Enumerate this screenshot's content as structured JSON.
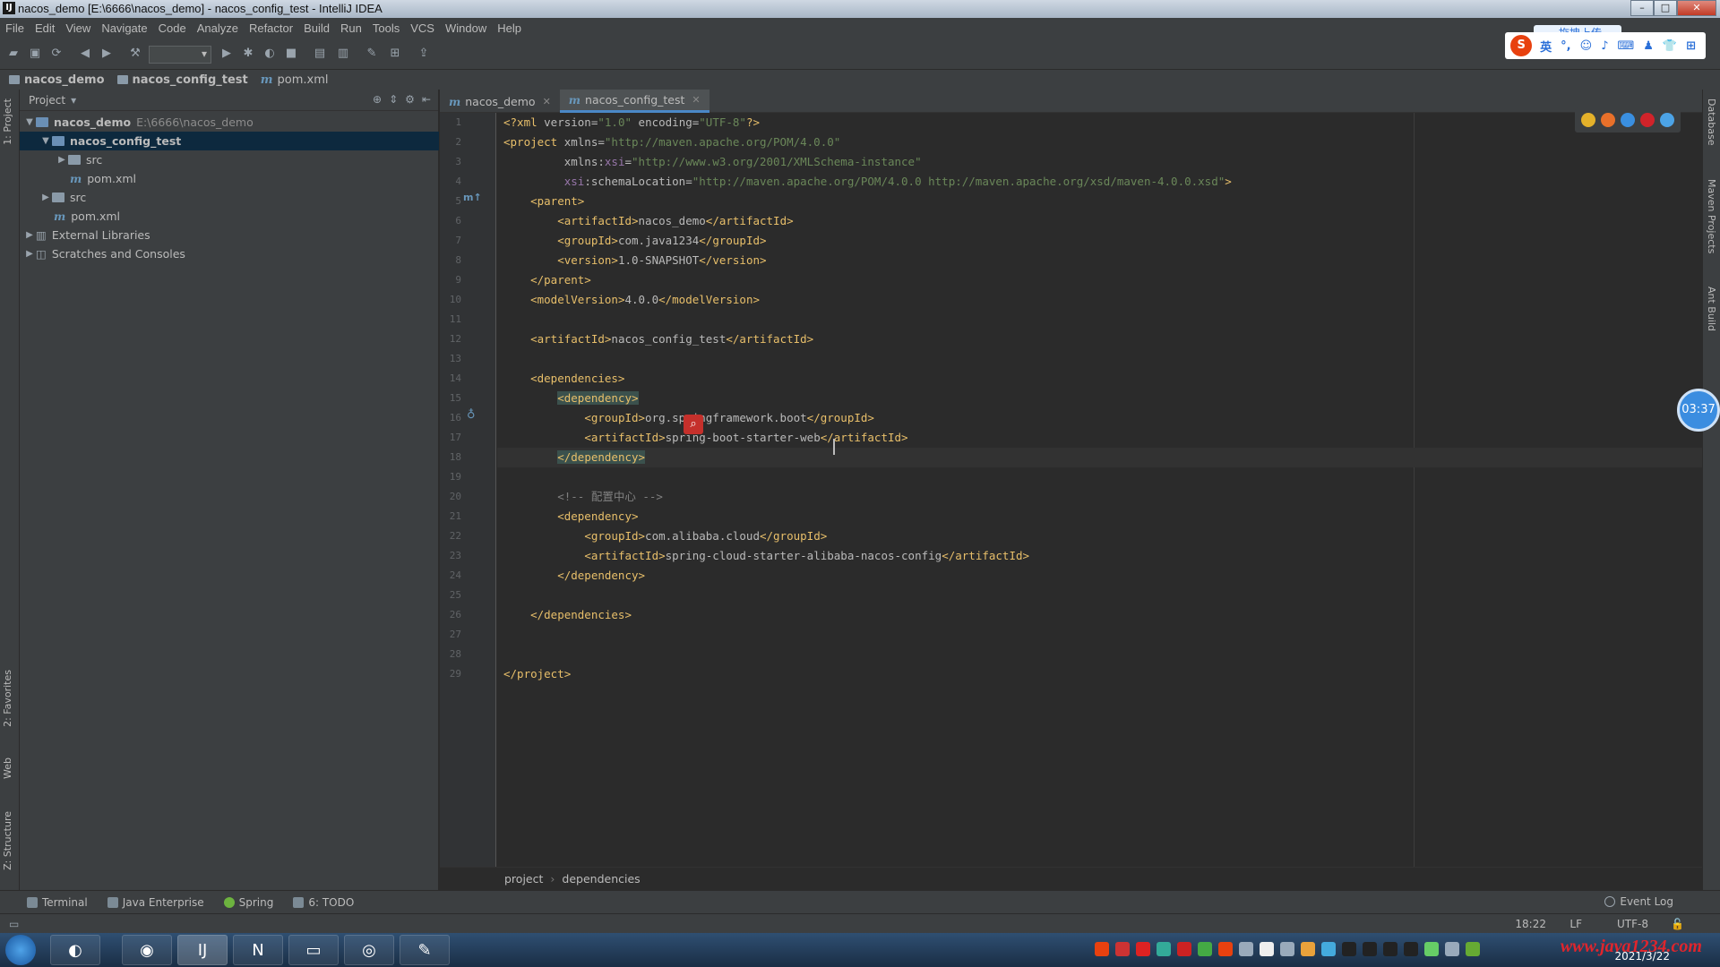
{
  "window": {
    "title": "nacos_demo [E:\\6666\\nacos_demo] - nacos_config_test - IntelliJ IDEA",
    "app_icon": "IJ"
  },
  "menu": [
    "File",
    "Edit",
    "View",
    "Navigate",
    "Code",
    "Analyze",
    "Refactor",
    "Build",
    "Run",
    "Tools",
    "VCS",
    "Window",
    "Help"
  ],
  "ime": {
    "upload_label": "拖拽上传",
    "items": [
      "英",
      "°,",
      "☺",
      "♪",
      "⌨",
      "♟",
      "👕",
      "⊞"
    ]
  },
  "breadcrumb": [
    "nacos_demo",
    "nacos_config_test",
    "pom.xml"
  ],
  "project_panel": {
    "title": "Project",
    "tree": [
      {
        "label": "nacos_demo",
        "extra": "E:\\6666\\nacos_demo",
        "type": "module",
        "expanded": true,
        "depth": 0
      },
      {
        "label": "nacos_config_test",
        "type": "module",
        "expanded": true,
        "depth": 1,
        "selected": true
      },
      {
        "label": "src",
        "type": "folder",
        "expanded": false,
        "depth": 2
      },
      {
        "label": "pom.xml",
        "type": "maven",
        "depth": 2
      },
      {
        "label": "src",
        "type": "folder",
        "expanded": false,
        "depth": 1
      },
      {
        "label": "pom.xml",
        "type": "maven",
        "depth": 1
      },
      {
        "label": "External Libraries",
        "type": "lib",
        "expanded": false,
        "depth": 0
      },
      {
        "label": "Scratches and Consoles",
        "type": "scratch",
        "expanded": false,
        "depth": 0
      }
    ]
  },
  "left_tool_tabs": [
    "1: Project",
    "2: Favorites",
    "Web",
    "Z: Structure"
  ],
  "right_tool_tabs": [
    "Database",
    "Maven Projects",
    "Ant Build"
  ],
  "editor_tabs": [
    {
      "label": "nacos_demo",
      "active": false
    },
    {
      "label": "nacos_config_test",
      "active": true
    }
  ],
  "code_lines": [
    "<?xml version=\"1.0\" encoding=\"UTF-8\"?>",
    "<project xmlns=\"http://maven.apache.org/POM/4.0.0\"",
    "         xmlns:xsi=\"http://www.w3.org/2001/XMLSchema-instance\"",
    "         xsi:schemaLocation=\"http://maven.apache.org/POM/4.0.0 http://maven.apache.org/xsd/maven-4.0.0.xsd\">",
    "    <parent>",
    "        <artifactId>nacos_demo</artifactId>",
    "        <groupId>com.java1234</groupId>",
    "        <version>1.0-SNAPSHOT</version>",
    "    </parent>",
    "    <modelVersion>4.0.0</modelVersion>",
    "",
    "    <artifactId>nacos_config_test</artifactId>",
    "",
    "    <dependencies>",
    "        <dependency>",
    "            <groupId>org.springframework.boot</groupId>",
    "            <artifactId>spring-boot-starter-web</artifactId>",
    "        </dependency>",
    "",
    "        <!-- 配置中心 -->",
    "        <dependency>",
    "            <groupId>com.alibaba.cloud</groupId>",
    "            <artifactId>spring-cloud-starter-alibaba-nacos-config</artifactId>",
    "        </dependency>",
    "",
    "    </dependencies>",
    "",
    "",
    "</project>"
  ],
  "editor_breadcrumb": [
    "project",
    "dependencies"
  ],
  "timer": "03:37",
  "bottom_tools": [
    "Terminal",
    "Java Enterprise",
    "Spring",
    "6: TODO"
  ],
  "event_log": "Event Log",
  "status": {
    "position": "18:22",
    "line_sep": "LF",
    "encoding": "UTF-8"
  },
  "taskbar": {
    "date": "2021/3/22",
    "watermark": "www.java1234.com"
  }
}
